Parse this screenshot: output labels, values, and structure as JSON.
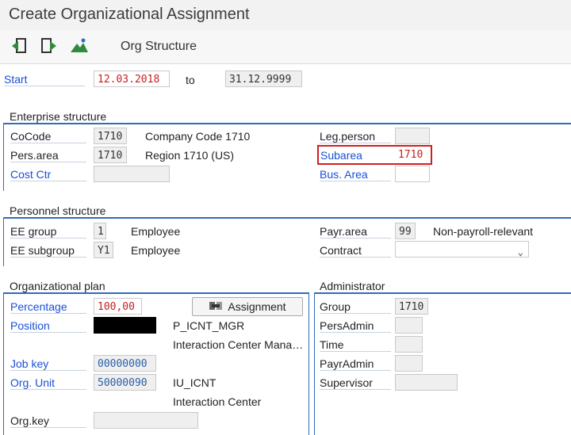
{
  "window": {
    "title": "Create Organizational Assignment"
  },
  "toolbar": {
    "org_structure_label": "Org Structure"
  },
  "validity": {
    "start_label": "Start",
    "start_value": "12.03.2018",
    "to_label": "to",
    "end_value": "31.12.9999"
  },
  "enterprise": {
    "title": "Enterprise structure",
    "cocode_label": "CoCode",
    "cocode_value": "1710",
    "cocode_text": "Company Code 1710",
    "persarea_label": "Pers.area",
    "persarea_value": "1710",
    "persarea_text": "Region 1710 (US)",
    "costctr_label": "Cost Ctr",
    "costctr_value": "",
    "legperson_label": "Leg.person",
    "legperson_value": "",
    "subarea_label": "Subarea",
    "subarea_value": "1710",
    "busarea_label": "Bus. Area",
    "busarea_value": ""
  },
  "personnel": {
    "title": "Personnel structure",
    "eegroup_label": "EE group",
    "eegroup_value": "1",
    "eegroup_text": "Employee",
    "eesubgroup_label": "EE subgroup",
    "eesubgroup_value": "Y1",
    "eesubgroup_text": "Employee",
    "payrarea_label": "Payr.area",
    "payrarea_value": "99",
    "payrarea_text": "Non-payroll-relevant",
    "contract_label": "Contract",
    "contract_value": ""
  },
  "orgplan": {
    "title": "Organizational plan",
    "percentage_label": "Percentage",
    "percentage_value": "100,00",
    "assignment_button": "Assignment",
    "position_label": "Position",
    "position_code": "P_ICNT_MGR",
    "position_text": "Interaction Center Mana…",
    "jobkey_label": "Job key",
    "jobkey_value": "00000000",
    "orgunit_label": "Org. Unit",
    "orgunit_value": "50000090",
    "orgunit_code": "IU_ICNT",
    "orgunit_text": "Interaction Center",
    "orgkey_label": "Org.key",
    "orgkey_value": ""
  },
  "administrator": {
    "title": "Administrator",
    "group_label": "Group",
    "group_value": "1710",
    "persadmin_label": "PersAdmin",
    "time_label": "Time",
    "payradmin_label": "PayrAdmin",
    "supervisor_label": "Supervisor"
  },
  "colors": {
    "accent": "#2f6db5",
    "highlight": "#d11f1f",
    "required_text": "#c81e1e",
    "link_label": "#1a4fd6"
  },
  "icons": [
    "back-icon",
    "forward-icon",
    "mountain-icon",
    "org-structure-icon"
  ]
}
